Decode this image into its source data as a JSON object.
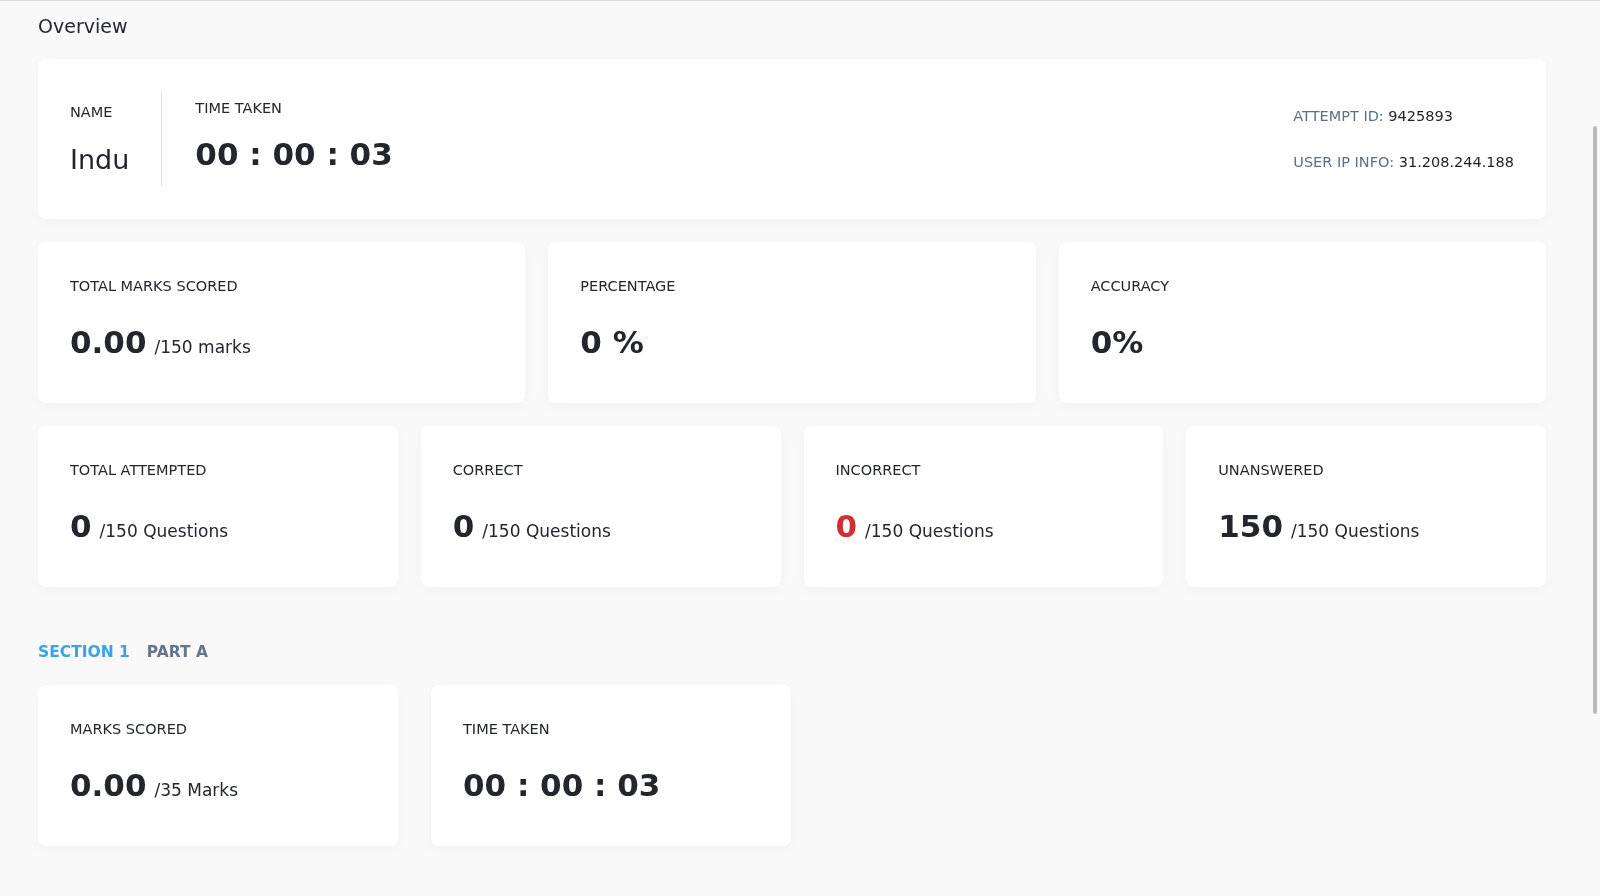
{
  "page_title": "Overview",
  "summary": {
    "name_label": "NAME",
    "name": "Indu",
    "time_label": "TIME TAKEN",
    "time": "00 : 00 : 03",
    "attempt_id_label": "ATTEMPT ID:",
    "attempt_id": "9425893",
    "ip_label": "USER IP INFO:",
    "ip": "31.208.244.188"
  },
  "score_cards": [
    {
      "label": "TOTAL MARKS SCORED",
      "value": "0.00",
      "unit": "/150 marks"
    },
    {
      "label": "PERCENTAGE",
      "value": "0 %"
    },
    {
      "label": "ACCURACY",
      "value": "0%"
    }
  ],
  "question_cards": [
    {
      "label": "TOTAL ATTEMPTED",
      "value": "0",
      "unit": "/150 Questions",
      "color": "#24262e"
    },
    {
      "label": "CORRECT",
      "value": "0",
      "unit": "/150 Questions",
      "color": "#24262e"
    },
    {
      "label": "INCORRECT",
      "value": "0",
      "unit": "/150 Questions",
      "color": "#d0302f"
    },
    {
      "label": "UNANSWERED",
      "value": "150",
      "unit": "/150 Questions",
      "color": "#24262e"
    }
  ],
  "section_tabs": [
    {
      "label": "SECTION 1",
      "selected": true
    },
    {
      "label": "PART A",
      "selected": false
    }
  ],
  "section_cards": [
    {
      "label": "MARKS SCORED",
      "value": "0.00",
      "unit": "/35 Marks"
    },
    {
      "label": "TIME TAKEN",
      "value": "00 : 00 : 03"
    }
  ]
}
